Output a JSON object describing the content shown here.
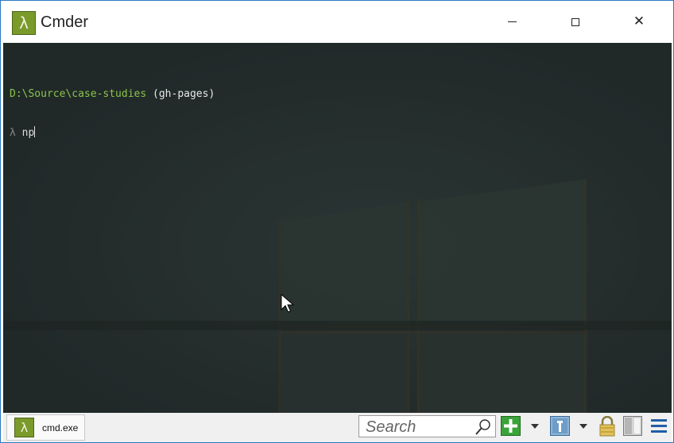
{
  "window": {
    "title": "Cmder",
    "app_icon_glyph": "λ",
    "icon_color": "#7a9a2a",
    "minimize_icon": "minimize-icon",
    "maximize_icon": "maximize-icon",
    "close_icon": "close-icon",
    "close_glyph": "✕"
  },
  "console": {
    "path": "D:\\Source\\case-studies",
    "branch": " (gh-pages)",
    "prompt": "λ",
    "command": "np",
    "path_color": "#8bc34a",
    "background_color": "#242a27"
  },
  "statusbar": {
    "tab_label": "cmd.exe",
    "tab_icon_glyph": "λ",
    "search_placeholder": "Search",
    "icons": [
      "new-console-icon",
      "dropdown-arrow-icon",
      "panel-icon",
      "dropdown-arrow-icon",
      "lock-icon",
      "split-pane-icon",
      "menu-icon"
    ]
  }
}
